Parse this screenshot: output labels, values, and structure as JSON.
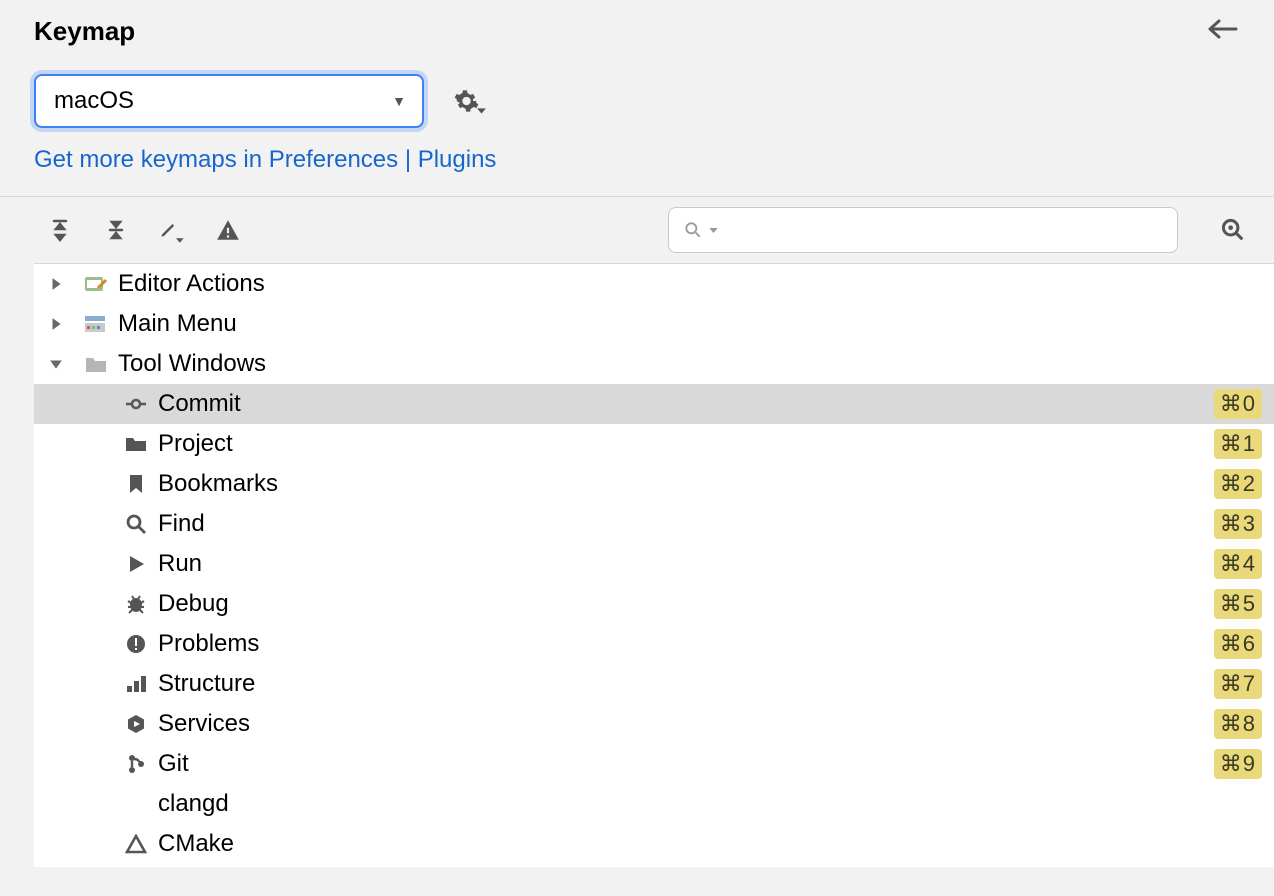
{
  "title": "Keymap",
  "selector": {
    "value": "macOS"
  },
  "link_text": "Get more keymaps in Preferences | Plugins",
  "search": {
    "placeholder": ""
  },
  "tree": {
    "top": [
      {
        "label": "Editor Actions",
        "expanded": false,
        "icon": "editor"
      },
      {
        "label": "Main Menu",
        "expanded": false,
        "icon": "menu"
      },
      {
        "label": "Tool Windows",
        "expanded": true,
        "icon": "folder"
      }
    ],
    "tool_windows": [
      {
        "label": "Commit",
        "shortcut": "⌘0",
        "icon": "commit",
        "selected": true
      },
      {
        "label": "Project",
        "shortcut": "⌘1",
        "icon": "folder-s",
        "selected": false
      },
      {
        "label": "Bookmarks",
        "shortcut": "⌘2",
        "icon": "bookmark",
        "selected": false
      },
      {
        "label": "Find",
        "shortcut": "⌘3",
        "icon": "search",
        "selected": false
      },
      {
        "label": "Run",
        "shortcut": "⌘4",
        "icon": "play",
        "selected": false
      },
      {
        "label": "Debug",
        "shortcut": "⌘5",
        "icon": "bug",
        "selected": false
      },
      {
        "label": "Problems",
        "shortcut": "⌘6",
        "icon": "problems",
        "selected": false
      },
      {
        "label": "Structure",
        "shortcut": "⌘7",
        "icon": "structure",
        "selected": false
      },
      {
        "label": "Services",
        "shortcut": "⌘8",
        "icon": "services",
        "selected": false
      },
      {
        "label": "Git",
        "shortcut": "⌘9",
        "icon": "git",
        "selected": false
      },
      {
        "label": "clangd",
        "shortcut": "",
        "icon": "",
        "selected": false
      },
      {
        "label": "CMake",
        "shortcut": "",
        "icon": "cmake",
        "selected": false
      }
    ]
  }
}
